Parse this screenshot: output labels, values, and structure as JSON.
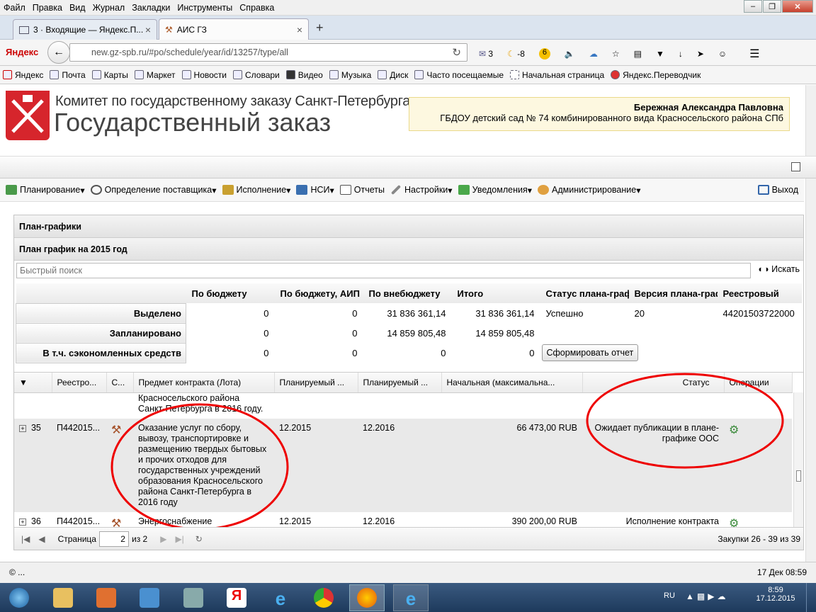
{
  "menubar": [
    "Файл",
    "Правка",
    "Вид",
    "Журнал",
    "Закладки",
    "Инструменты",
    "Справка"
  ],
  "tabs": [
    {
      "label": "3 · Входящие — Яндекс.П..."
    },
    {
      "label": "АИС ГЗ"
    }
  ],
  "nav": {
    "url": "new.gz-spb.ru/#po/schedule/year/id/13257/type/all",
    "yandex": "Яндекс",
    "mail_count": "3",
    "weather": "-8",
    "badge": "6"
  },
  "bookmarks": [
    "Яндекс",
    "Почта",
    "Карты",
    "Маркет",
    "Новости",
    "Словари",
    "Видео",
    "Музыка",
    "Диск",
    "Часто посещаемые",
    "Начальная страница",
    "Яндекс.Переводчик"
  ],
  "header": {
    "logo_top": "Комитет по государственному заказу Санкт-Петербурга",
    "logo_bottom": "Государственный заказ",
    "user_name": "Бережная Александра Павловна",
    "user_org": "ГБДОУ детский сад № 74 комбинированного вида Красносельского района СПб"
  },
  "toolbar": [
    "Планирование",
    "Определение поставщика",
    "Исполнение",
    "НСИ",
    "Отчеты",
    "Настройки",
    "Уведомления",
    "Администрирование"
  ],
  "logout": "Выход",
  "panel": {
    "title": "План-графики",
    "subtitle": "План график на 2015 год",
    "search_placeholder": "Быстрый поиск",
    "search_button": "Искать"
  },
  "summary": {
    "headers": [
      "По бюджету",
      "По бюджету, АИП",
      "По внебюджету",
      "Итого",
      "Статус плана-графика",
      "Версия плана-графика",
      "Реестровый"
    ],
    "rows": [
      {
        "label": "Выделено",
        "values": [
          "0",
          "0",
          "31 836 361,14",
          "31 836 361,14"
        ],
        "status": "Успешно",
        "version": "20",
        "reestr": "44201503722000"
      },
      {
        "label": "Запланировано",
        "values": [
          "0",
          "0",
          "14 859 805,48",
          "14 859 805,48"
        ]
      },
      {
        "label": "В т.ч. сэкономленных средств",
        "values": [
          "0",
          "0",
          "0",
          "0"
        ]
      }
    ],
    "report_button": "Сформировать отчет"
  },
  "grid": {
    "headers": [
      "Реестро...",
      "С...",
      "Предмет контракта (Лота)",
      "Планируемый ...",
      "Планируемый ...",
      "Начальная (максимальна...",
      "Статус",
      "Операции"
    ],
    "partial_text": "Красносельского района Санкт-Петербурга в 2016 году.",
    "rows": [
      {
        "num": "35",
        "reg": "П442015...",
        "subject": "Оказание услуг по сбору, вывозу, транспортировке и размещению твердых бытовых и прочих отходов для государственных учреждений образования Красносельского района Санкт-Петербурга в 2016 году",
        "plan1": "12.2015",
        "plan2": "12.2016",
        "price": "66 473,00 RUB",
        "status": "Ожидает публикации в плане-графике ООС"
      },
      {
        "num": "36",
        "reg": "П442015...",
        "subject": "Энергоснабжение",
        "plan1": "12.2015",
        "plan2": "12.2016",
        "price": "390 200,00 RUB",
        "status": "Исполнение контракта"
      }
    ]
  },
  "pager": {
    "page_label": "Страница",
    "page": "2",
    "of": "из 2",
    "info": "Закупки 26 - 39 из 39"
  },
  "statusbar": {
    "left": "© ...",
    "right": "17 Дек 08:59"
  },
  "taskbar": {
    "lang": "RU",
    "time": "8:59",
    "date": "17.12.2015"
  }
}
